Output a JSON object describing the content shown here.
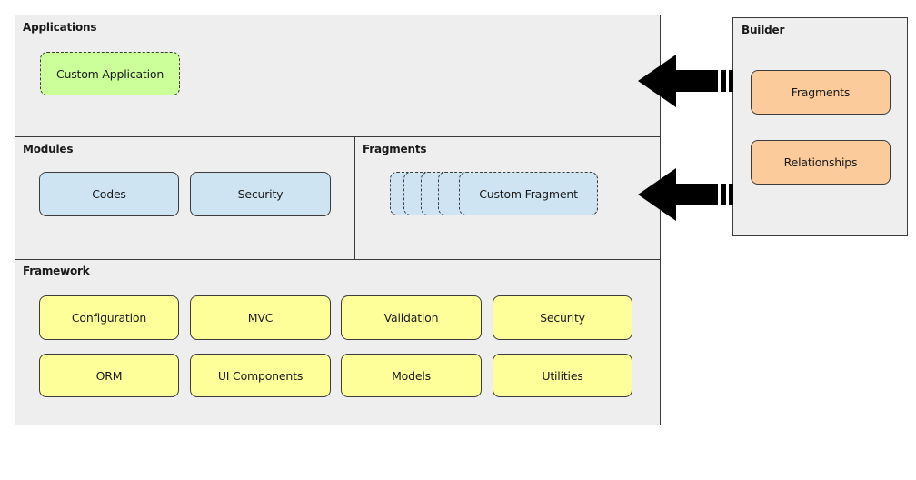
{
  "main": {
    "applications": {
      "title": "Applications",
      "items": [
        {
          "label": "Custom Application"
        }
      ]
    },
    "modules": {
      "title": "Modules",
      "items": [
        {
          "label": "Codes"
        },
        {
          "label": "Security"
        }
      ]
    },
    "fragments": {
      "title": "Fragments",
      "items": [
        {
          "label": "Custom Fragment"
        }
      ],
      "stacked_count": 5
    },
    "framework": {
      "title": "Framework",
      "items": [
        {
          "label": "Configuration"
        },
        {
          "label": "MVC"
        },
        {
          "label": "Validation"
        },
        {
          "label": "Security"
        },
        {
          "label": "ORM"
        },
        {
          "label": "UI Components"
        },
        {
          "label": "Models"
        },
        {
          "label": "Utilities"
        }
      ]
    }
  },
  "builder": {
    "title": "Builder",
    "items": [
      {
        "label": "Fragments"
      },
      {
        "label": "Relationships"
      }
    ]
  },
  "arrows": [
    {
      "from": "builder",
      "to": "applications",
      "icon": "left-arrow"
    },
    {
      "from": "builder",
      "to": "fragments",
      "icon": "left-arrow"
    }
  ],
  "colors": {
    "panel_bg": "#eeeeee",
    "framework_box": "#ffff99",
    "module_box": "#cfe4f3",
    "builder_box": "#fbcb9b",
    "application_box": "#ccff99"
  }
}
